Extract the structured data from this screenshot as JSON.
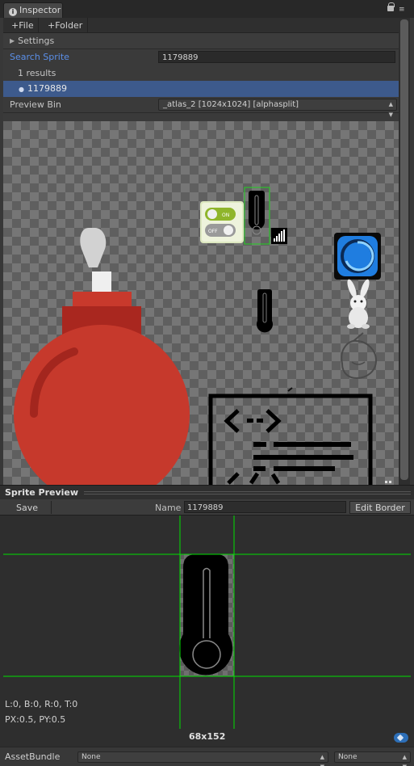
{
  "tab": {
    "title": "Inspector"
  },
  "toolbar": {
    "file_label": "+File",
    "folder_label": "+Folder"
  },
  "settings": {
    "label": "Settings"
  },
  "search": {
    "label": "Search Sprite",
    "value": "1179889"
  },
  "results": {
    "count_text": "1 results",
    "items": [
      "1179889"
    ]
  },
  "preview_bin": {
    "label": "Preview Bin",
    "value": "_atlas_2  [1024x1024]  [alphasplit]"
  },
  "atlas": {
    "toggle_on": "ON",
    "toggle_off": "OFF"
  },
  "sprite_preview": {
    "header": "Sprite Preview",
    "save_label": "Save",
    "name_label": "Name",
    "name_value": "1179889",
    "edit_border_label": "Edit Border",
    "border_info": "L:0, B:0, R:0, T:0",
    "pivot_info": "PX:0.5, PY:0.5",
    "size": "68x152"
  },
  "asset_bundle": {
    "label": "AssetBundle",
    "name_value": "None",
    "variant_value": "None"
  },
  "colors": {
    "selection": "#3d5a8c",
    "guide_lines": "#00e000",
    "link_blue": "#5b8fe8",
    "bomb_red": "#c0392b"
  }
}
